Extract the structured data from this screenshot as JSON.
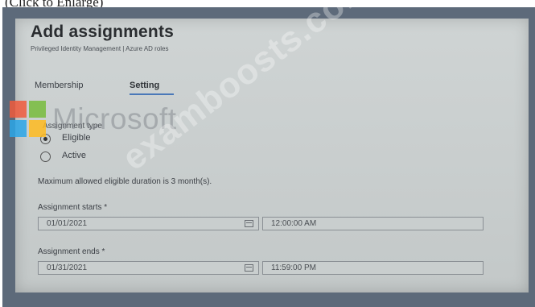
{
  "caption": "(Click to Enlarge)",
  "header": {
    "title": "Add assignments",
    "subtitle": "Privileged Identity Management | Azure AD roles"
  },
  "tabs": [
    {
      "label": "Membership"
    },
    {
      "label": "Setting"
    }
  ],
  "assignment_type": {
    "label": "Assignment type",
    "options": [
      {
        "label": "Eligible",
        "selected": true
      },
      {
        "label": "Active",
        "selected": false
      }
    ]
  },
  "max_duration_text": "Maximum allowed eligible duration is 3 month(s).",
  "assignment_starts": {
    "label": "Assignment starts *",
    "date": "01/01/2021",
    "time": "12:00:00 AM"
  },
  "assignment_ends": {
    "label": "Assignment ends *",
    "date": "01/31/2021",
    "time": "11:59:00 PM"
  },
  "overlay": {
    "logo_word": "Microsoft",
    "watermark": "examboosts.com",
    "logo_colors": [
      "#f05a3c",
      "#78bc3c",
      "#2aa6e8",
      "#ffbb20"
    ]
  }
}
